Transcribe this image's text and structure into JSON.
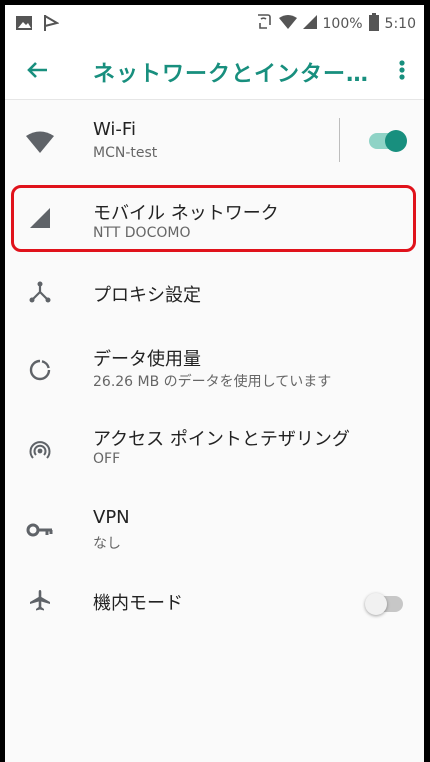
{
  "status_bar": {
    "battery_percent": "100%",
    "time": "5:10"
  },
  "toolbar": {
    "title": "ネットワークとインター…"
  },
  "items": [
    {
      "title": "Wi-Fi",
      "subtitle": "MCN-test",
      "icon": "wifi-icon",
      "toggle_on": true
    },
    {
      "title": "モバイル ネットワーク",
      "subtitle": "NTT DOCOMO",
      "icon": "cell-signal-icon"
    },
    {
      "title": "プロキシ設定",
      "icon": "proxy-icon"
    },
    {
      "title": "データ使用量",
      "subtitle": "26.26 MB のデータを使用しています",
      "icon": "data-usage-icon"
    },
    {
      "title": "アクセス ポイントとテザリング",
      "subtitle": "OFF",
      "icon": "hotspot-icon"
    },
    {
      "title": "VPN",
      "subtitle": "なし",
      "icon": "vpn-key-icon"
    },
    {
      "title": "機内モード",
      "icon": "airplane-icon",
      "toggle_on": false
    }
  ],
  "colors": {
    "accent": "#188f7e",
    "highlight_border": "#e0121b"
  }
}
